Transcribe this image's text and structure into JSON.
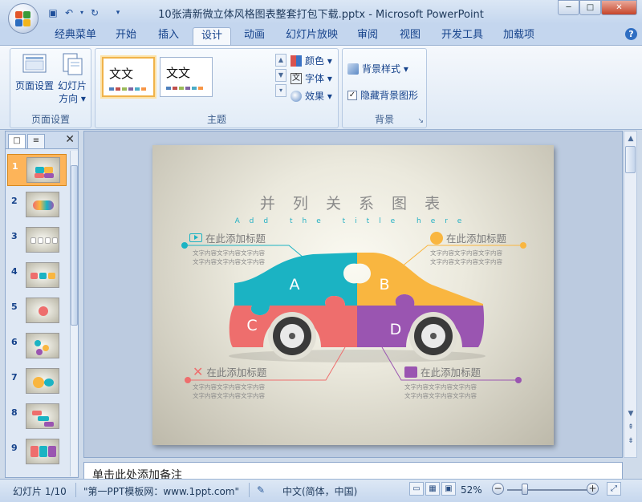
{
  "window": {
    "title": "10张清新微立体风格图表整套打包下载.pptx - Microsoft PowerPoint",
    "min": "─",
    "max": "□",
    "close": "✕"
  },
  "qat": {
    "save_icon": "save-icon",
    "undo_icon": "undo-icon",
    "redo_icon": "redo-icon",
    "customize_icon": "customize-qat-icon"
  },
  "tabs": [
    {
      "label": "经典菜单"
    },
    {
      "label": "开始"
    },
    {
      "label": "插入"
    },
    {
      "label": "设计",
      "active": true
    },
    {
      "label": "动画"
    },
    {
      "label": "幻灯片放映"
    },
    {
      "label": "审阅"
    },
    {
      "label": "视图"
    },
    {
      "label": "开发工具"
    },
    {
      "label": "加载项"
    }
  ],
  "help": "?",
  "ribbon": {
    "page_setup": {
      "label": "页面设置",
      "page_setup_btn": "页面设置",
      "orientation_line1": "幻灯片",
      "orientation_line2": "方向 ▾"
    },
    "themes": {
      "label": "主题",
      "theme1": "文文",
      "theme2": "文文",
      "colors": "颜色 ▾",
      "fonts": "字体 ▾",
      "effects": "效果 ▾"
    },
    "background": {
      "label": "背景",
      "styles": "背景样式 ▾",
      "hide_graphics": "隐藏背景图形",
      "hide_graphics_checked": true
    }
  },
  "slides_panel": {
    "tab1": "□",
    "tab2": "≡",
    "close": "✕",
    "slides": [
      "1",
      "2",
      "3",
      "4",
      "5",
      "6",
      "7",
      "8",
      "9"
    ],
    "active": 1
  },
  "slide": {
    "title": "并 列 关 系 图 表",
    "subtitle": "Add the title here",
    "pieces": {
      "a": "A",
      "b": "B",
      "c": "C",
      "d": "D"
    },
    "callouts": [
      {
        "title": "在此添加标题",
        "body1": "文字内容文字内容文字内容",
        "body2": "文字内容文字内容文字内容"
      },
      {
        "title": "在此添加标题",
        "body1": "文字内容文字内容文字内容",
        "body2": "文字内容文字内容文字内容"
      },
      {
        "title": "在此添加标题",
        "body1": "文字内容文字内容文字内容",
        "body2": "文字内容文字内容文字内容"
      },
      {
        "title": "在此添加标题",
        "body1": "文字内容文字内容文字内容",
        "body2": "文字内容文字内容文字内容"
      }
    ],
    "colors": {
      "teal": "#1bb3c3",
      "yellow": "#f9b640",
      "coral": "#ee6e6d",
      "purple": "#9a55b1"
    }
  },
  "notes": {
    "text": "单击此处添加备注"
  },
  "status": {
    "slide": "幻灯片 1/10",
    "theme": "\"第一PPT模板网：www.1ppt.com\"",
    "language": "中文(简体，中国)",
    "zoom": "52%",
    "zoom_minus": "−",
    "zoom_plus": "+"
  }
}
